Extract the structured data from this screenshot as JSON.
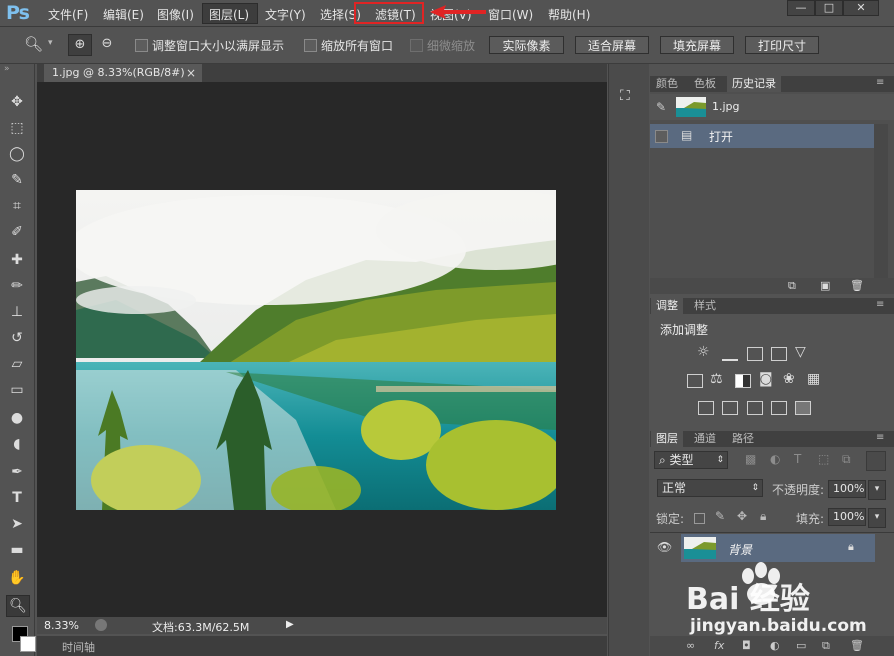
{
  "app": {
    "logo": "Ps"
  },
  "menu": {
    "items": [
      "文件(F)",
      "编辑(E)",
      "图像(I)",
      "图层(L)",
      "文字(Y)",
      "选择(S)",
      "滤镜(T)",
      "视图(V)",
      "窗口(W)",
      "帮助(H)"
    ],
    "active_item": "图层(L)",
    "highlighted_item": "滤镜(T)"
  },
  "window_controls": {
    "minimize": "—",
    "restore": "□",
    "close": "✕"
  },
  "options": {
    "resize_window_label": "调整窗口大小以满屏显示",
    "zoom_all_label": "缩放所有窗口",
    "scrubby_zoom_label": "细微缩放",
    "actual_pixels": "实际像素",
    "fit_screen": "适合屏幕",
    "fill_screen": "填充屏幕",
    "print_size": "打印尺寸"
  },
  "document": {
    "tab_title": "1.jpg @ 8.33%(RGB/8#)",
    "tab_close": "×",
    "zoom": "8.33%",
    "doc_info": "文档:63.3M/62.5M"
  },
  "timeline": {
    "label": "时间轴"
  },
  "history_panel": {
    "tabs": [
      "颜色",
      "色板",
      "历史记录"
    ],
    "active_tab": "历史记录",
    "snapshot_name": "1.jpg",
    "states": [
      "打开"
    ]
  },
  "adjust_panel": {
    "tabs": [
      "调整",
      "样式"
    ],
    "active_tab": "调整",
    "heading": "添加调整"
  },
  "layers_panel": {
    "tabs": [
      "图层",
      "通道",
      "路径"
    ],
    "active_tab": "图层",
    "filter_kind": "类型",
    "blend_mode": "正常",
    "opacity_label": "不透明度:",
    "opacity_value": "100%",
    "lock_label": "锁定:",
    "fill_label": "填充:",
    "fill_value": "100%",
    "layers": [
      {
        "name": "背景",
        "locked": true,
        "visible": true
      }
    ]
  },
  "watermark": {
    "brand": "Bai 经验",
    "url": "jingyan.baidu.com"
  },
  "colors": {
    "highlight_red": "#e02424",
    "panel_bg": "#535353",
    "canvas_bg": "#282828",
    "selected_row": "#5a6a80"
  }
}
